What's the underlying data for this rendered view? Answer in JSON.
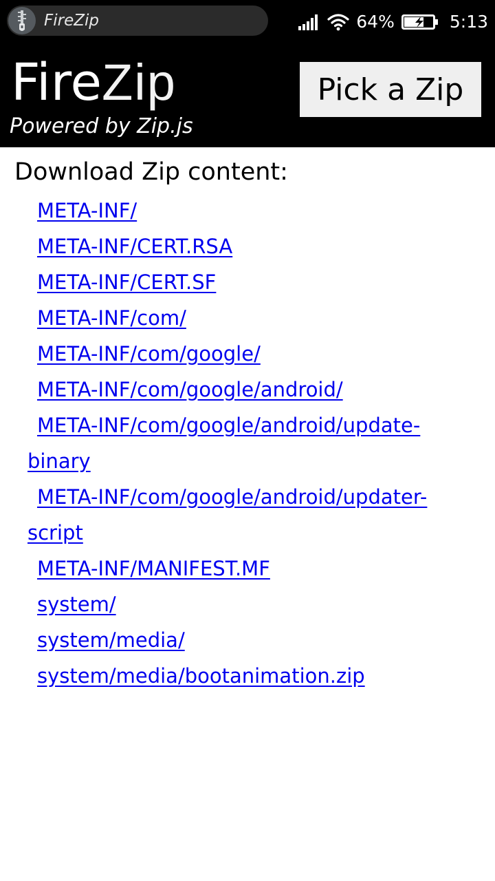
{
  "status_bar": {
    "notification_title": "FireZip",
    "battery_percent": "64%",
    "time": "5:13",
    "icons": [
      "zipper-icon",
      "signal-icon",
      "wifi-icon",
      "battery-icon"
    ]
  },
  "header": {
    "logo_fire": "Fire",
    "logo_zip": "Zip",
    "subtitle": "Powered by Zip.js",
    "pick_button_label": "Pick a Zip"
  },
  "content": {
    "heading": "Download Zip content:",
    "files": [
      "META-INF/",
      "META-INF/CERT.RSA",
      "META-INF/CERT.SF",
      "META-INF/com/",
      "META-INF/com/google/",
      "META-INF/com/google/android/",
      "META-INF/com/google/android/update-binary",
      "META-INF/com/google/android/updater-script",
      "META-INF/MANIFEST.MF",
      "system/",
      "system/media/",
      "system/media/bootanimation.zip"
    ]
  },
  "colors": {
    "header_bg": "#000000",
    "button_bg": "#efefef",
    "link": "#0000ee"
  }
}
